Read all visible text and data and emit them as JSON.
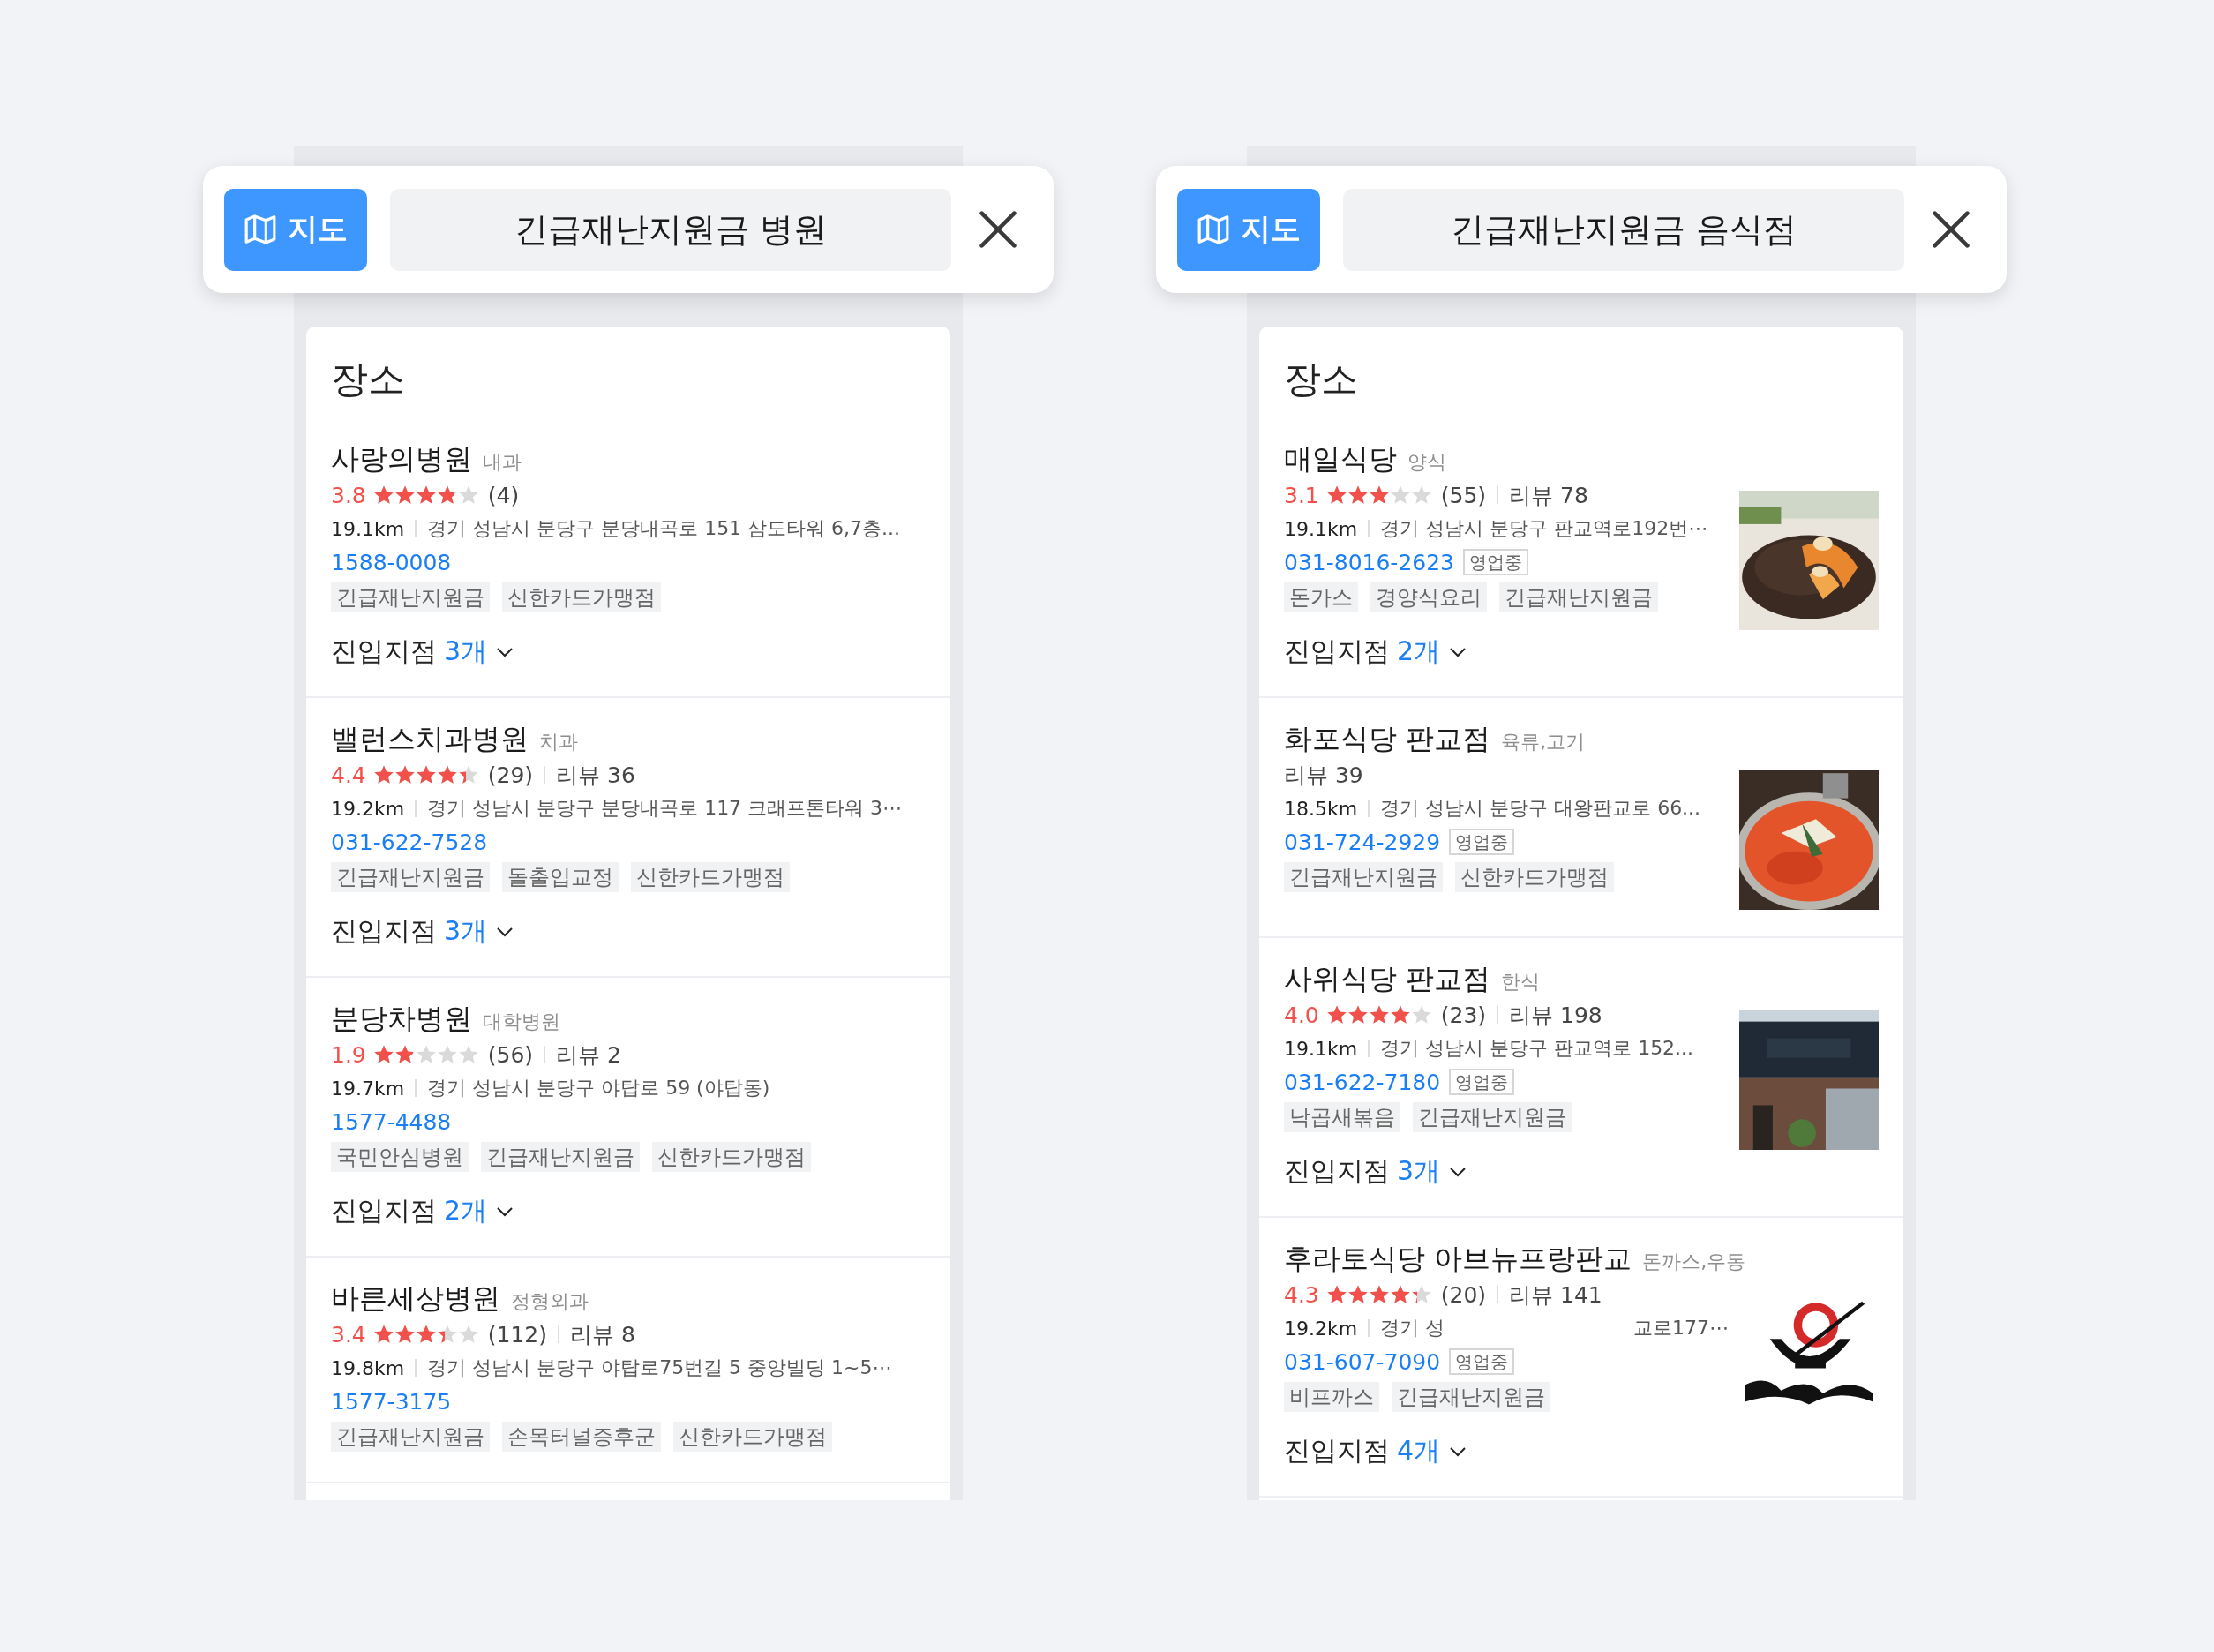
{
  "panels": [
    {
      "search": {
        "map_button": "지도",
        "query": "긴급재난지원금 병원"
      },
      "section_title": "장소",
      "places": [
        {
          "name": "사랑의병원",
          "category": "내과",
          "rating": "3.8",
          "stars": 3.8,
          "rating_count": "(4)",
          "distance": "19.1km",
          "address": "경기 성남시 분당구 분당내곡로 151 삼도타워 6,7층...",
          "phone": "1588-0008",
          "tags": [
            "긴급재난지원금",
            "신한카드가맹점"
          ],
          "entrance_label": "진입지점",
          "entrance_count": "3개"
        },
        {
          "name": "밸런스치과병원",
          "category": "치과",
          "rating": "4.4",
          "stars": 4.4,
          "rating_count": "(29)",
          "review": "리뷰 36",
          "distance": "19.2km",
          "address": "경기 성남시 분당구 분당내곡로 117 크래프톤타워 3⋯",
          "phone": "031-622-7528",
          "tags": [
            "긴급재난지원금",
            "돌출입교정",
            "신한카드가맹점"
          ],
          "entrance_label": "진입지점",
          "entrance_count": "3개"
        },
        {
          "name": "분당차병원",
          "category": "대학병원",
          "rating": "1.9",
          "stars": 1.9,
          "rating_count": "(56)",
          "review": "리뷰 2",
          "distance": "19.7km",
          "address": "경기 성남시 분당구 야탑로 59 (야탑동)",
          "phone": "1577-4488",
          "tags": [
            "국민안심병원",
            "긴급재난지원금",
            "신한카드가맹점"
          ],
          "entrance_label": "진입지점",
          "entrance_count": "2개"
        },
        {
          "name": "바른세상병원",
          "category": "정형외과",
          "rating": "3.4",
          "stars": 3.4,
          "rating_count": "(112)",
          "review": "리뷰 8",
          "distance": "19.8km",
          "address": "경기 성남시 분당구 야탑로75번길 5 중앙빌딩 1~5⋯",
          "phone": "1577-3175",
          "tags": [
            "긴급재난지원금",
            "손목터널증후군",
            "신한카드가맹점"
          ]
        }
      ]
    },
    {
      "search": {
        "map_button": "지도",
        "query": "긴급재난지원금 음식점"
      },
      "section_title": "장소",
      "places": [
        {
          "name": "매일식당",
          "category": "양식",
          "rating": "3.1",
          "stars": 3.1,
          "rating_count": "(55)",
          "review": "리뷰 78",
          "distance": "19.1km",
          "address": "경기 성남시 분당구 판교역로192번⋯",
          "phone": "031-8016-2623",
          "status": "영업중",
          "tags": [
            "돈가스",
            "경양식요리",
            "긴급재난지원금"
          ],
          "entrance_label": "진입지점",
          "entrance_count": "2개",
          "photo": {
            "kind": "picture"
          }
        },
        {
          "name": "화포식당 판교점",
          "category": "육류,고기",
          "review": "리뷰 39",
          "distance": "18.5km",
          "address": "경기 성남시 분당구 대왕판교로 66...",
          "phone": "031-724-2929",
          "status": "영업중",
          "tags": [
            "긴급재난지원금",
            "신한카드가맹점"
          ],
          "photo": {
            "kind": "picture"
          }
        },
        {
          "name": "사위식당 판교점",
          "category": "한식",
          "rating": "4.0",
          "stars": 4.0,
          "rating_count": "(23)",
          "review": "리뷰 198",
          "distance": "19.1km",
          "address": "경기 성남시 분당구 판교역로 152...",
          "phone": "031-622-7180",
          "status": "영업중",
          "tags": [
            "낙곱새볶음",
            "긴급재난지원금"
          ],
          "entrance_label": "진입지점",
          "entrance_count": "3개",
          "photo": {
            "kind": "picture"
          }
        },
        {
          "name": "후라토식당 아브뉴프랑판교",
          "category": "돈까스,우동",
          "rating": "4.3",
          "stars": 4.3,
          "rating_count": "(20)",
          "review": "리뷰 141",
          "distance": "19.2km",
          "address": "경기 성",
          "address_end": "교로177⋯",
          "phone": "031-607-7090",
          "status": "영업중",
          "tags": [
            "비프까스",
            "긴급재난지원금"
          ],
          "entrance_label": "진입지점",
          "entrance_count": "4개",
          "photo": {
            "kind": "picture"
          }
        }
      ]
    }
  ]
}
